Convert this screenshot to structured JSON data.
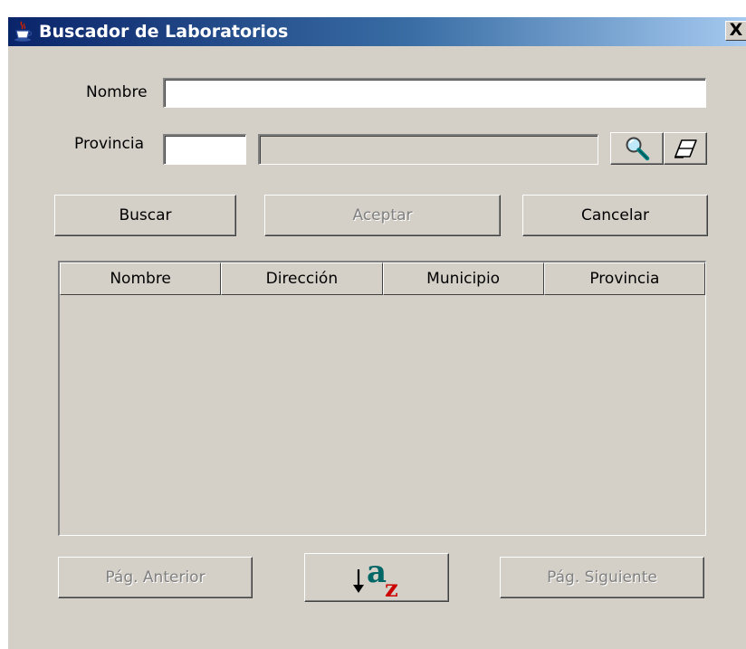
{
  "window": {
    "title": "Buscador de Laboratorios",
    "close_glyph": "X"
  },
  "form": {
    "nombre_label": "Nombre",
    "nombre_value": "",
    "provincia_label": "Provincia",
    "provincia_code_value": "",
    "provincia_name_value": ""
  },
  "buttons": {
    "buscar": "Buscar",
    "aceptar": "Aceptar",
    "cancelar": "Cancelar",
    "anterior": "Pág. Anterior",
    "siguiente": "Pág. Siguiente"
  },
  "table": {
    "columns": [
      "Nombre",
      "Dirección",
      "Municipio",
      "Provincia"
    ],
    "rows": []
  },
  "icons": {
    "title": "java-cup-icon",
    "search": "magnifier-icon",
    "clear": "eraser-icon",
    "sort": "sort-az-icon"
  },
  "colors": {
    "window_bg": "#d4d0c8",
    "title_start": "#0a246a",
    "title_end": "#a6caf0",
    "sort_a": "#006666",
    "sort_z": "#cc0000",
    "magnifier_handle": "#008080"
  }
}
